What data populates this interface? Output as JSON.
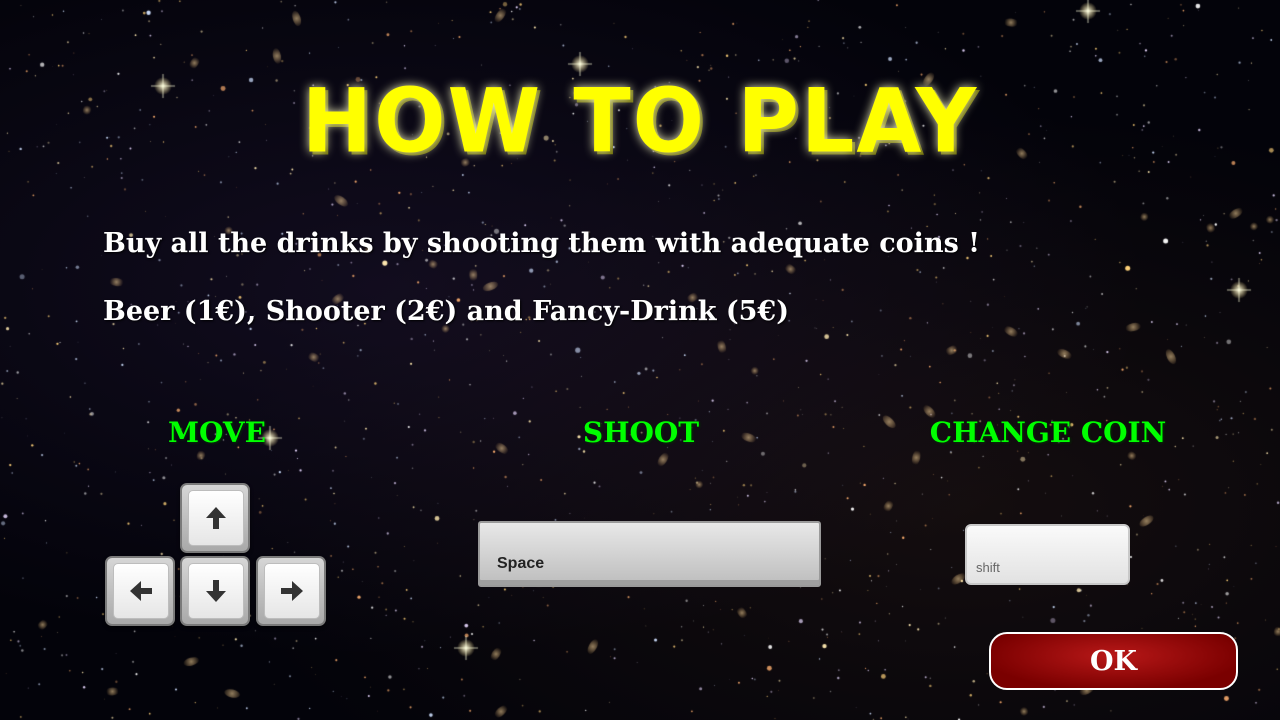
{
  "title": "HOW TO PLAY",
  "instructions": {
    "line1": "Buy all the drinks by shooting them with adequate coins !",
    "line2": "Beer (1€), Shooter (2€) and Fancy-Drink (5€)"
  },
  "controls": {
    "move_label": "MOVE",
    "shoot_label": "SHOOT",
    "change_coin_label": "CHANGE COIN",
    "space_key": "Space",
    "shift_key": "shift",
    "arrow_keys": [
      "up-arrow-icon",
      "left-arrow-icon",
      "down-arrow-icon",
      "right-arrow-icon"
    ]
  },
  "ok_button": "OK",
  "colors": {
    "title": "#ffff00",
    "section_labels": "#00ff00",
    "instructions": "#ffffff",
    "ok_button": "#9a0b0b",
    "background": "#03030a"
  }
}
